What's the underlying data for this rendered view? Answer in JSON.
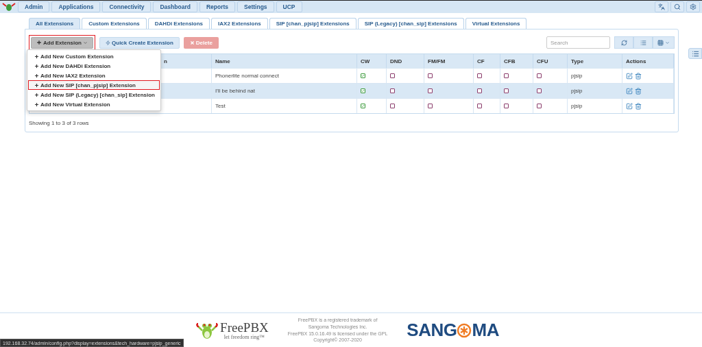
{
  "nav": {
    "items": [
      "Admin",
      "Applications",
      "Connectivity",
      "Dashboard",
      "Reports",
      "Settings",
      "UCP"
    ]
  },
  "tabs": [
    {
      "label": "All Extensions",
      "selected": true
    },
    {
      "label": "Custom Extensions",
      "selected": false
    },
    {
      "label": "DAHDi Extensions",
      "selected": false
    },
    {
      "label": "IAX2 Extensions",
      "selected": false
    },
    {
      "label": "SIP [chan_pjsip] Extensions",
      "selected": false
    },
    {
      "label": "SIP (Legacy) [chan_sip] Extensions",
      "selected": false
    },
    {
      "label": "Virtual Extensions",
      "selected": false
    }
  ],
  "toolbar": {
    "add": {
      "label": "Add Extension",
      "expanded": true
    },
    "quick": "Quick Create Extension",
    "delete": {
      "label": "Delete",
      "disabled": true
    },
    "search": {
      "placeholder": "Search"
    }
  },
  "add_menu": [
    {
      "label": "Add New Custom Extension",
      "highlighted": false
    },
    {
      "label": "Add New DAHDi Extension",
      "highlighted": false
    },
    {
      "label": "Add New IAX2 Extension",
      "highlighted": false
    },
    {
      "label": "Add New SIP [chan_pjsip] Extension",
      "highlighted": true
    },
    {
      "label": "Add New SIP (Legacy) [chan_sip] Extension",
      "highlighted": false
    },
    {
      "label": "Add New Virtual Extension",
      "highlighted": false
    }
  ],
  "table": {
    "columns": [
      "n",
      "Name",
      "CW",
      "DND",
      "FM/FM",
      "CF",
      "CFB",
      "CFU",
      "Type",
      "Actions"
    ],
    "rows": [
      {
        "name": "Phonerlite normal connect",
        "cw": true,
        "dnd": false,
        "fmfm": false,
        "cf": false,
        "cfb": false,
        "cfu": false,
        "type": "pjsip",
        "highlighted": false
      },
      {
        "name": "I'll be behind nat",
        "cw": true,
        "dnd": false,
        "fmfm": false,
        "cf": false,
        "cfb": false,
        "cfu": false,
        "type": "pjsip",
        "highlighted": true
      },
      {
        "name": "Test",
        "cw": true,
        "dnd": false,
        "fmfm": false,
        "cf": false,
        "cfb": false,
        "cfu": false,
        "type": "pjsip",
        "highlighted": false
      }
    ]
  },
  "pagination": "Showing 1 to 3 of 3 rows",
  "footer": {
    "freepbx_name": "FreePBX",
    "freepbx_tagline": "let freedom ring™",
    "legal": [
      "FreePBX is a registered trademark of",
      "Sangoma Technologies Inc.",
      "FreePBX 15.0.16.49 is licensed under the GPL",
      "Copyright© 2007-2020"
    ],
    "sangoma_left": "SANG",
    "sangoma_right": "MA"
  },
  "status_url": "192.168.32.74/admin/config.php?display=extensions&tech_hardware=pjsip_generic"
}
